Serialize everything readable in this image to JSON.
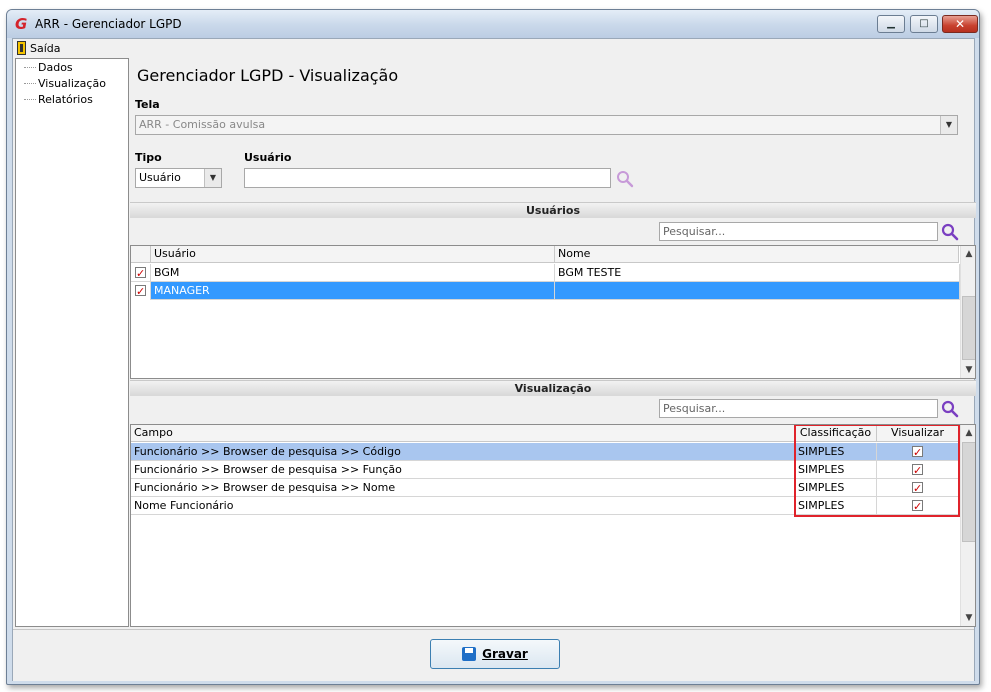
{
  "window": {
    "title": "ARR - Gerenciador LGPD",
    "app_icon": "G"
  },
  "menu": {
    "exit_label": "Saída"
  },
  "tree": {
    "items": [
      "Dados",
      "Visualização",
      "Relatórios"
    ]
  },
  "page": {
    "title": "Gerenciador LGPD - Visualização"
  },
  "tela": {
    "label": "Tela",
    "value": "ARR - Comissão avulsa"
  },
  "tipo": {
    "label": "Tipo",
    "value": "Usuário"
  },
  "usuario": {
    "label": "Usuário",
    "value": ""
  },
  "usuarios_section": {
    "title": "Usuários",
    "search_placeholder": "Pesquisar...",
    "columns": [
      "Usuário",
      "Nome"
    ],
    "rows": [
      {
        "checked": true,
        "usuario": "BGM",
        "nome": "BGM TESTE"
      },
      {
        "checked": true,
        "usuario": "MANAGER",
        "nome": ""
      }
    ]
  },
  "visualizacao_section": {
    "title": "Visualização",
    "search_placeholder": "Pesquisar...",
    "columns": [
      "Campo",
      "Classificação",
      "Visualizar"
    ],
    "rows": [
      {
        "campo": "Funcionário >> Browser de pesquisa >> Código",
        "classificacao": "SIMPLES",
        "visualizar": true
      },
      {
        "campo": "Funcionário >> Browser de pesquisa >> Função",
        "classificacao": "SIMPLES",
        "visualizar": true
      },
      {
        "campo": "Funcionário >> Browser de pesquisa >> Nome",
        "classificacao": "SIMPLES",
        "visualizar": true
      },
      {
        "campo": "Nome Funcionário",
        "classificacao": "SIMPLES",
        "visualizar": true
      }
    ]
  },
  "footer": {
    "save_label": "Gravar"
  },
  "colors": {
    "selection": "#3399ff",
    "highlight_box": "#e0232b",
    "search_icon": "#7a3fc1"
  }
}
